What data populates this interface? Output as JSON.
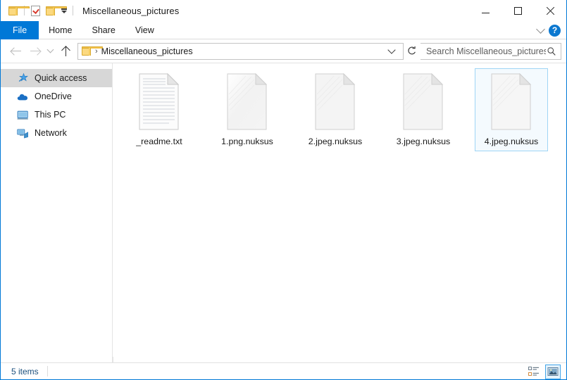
{
  "window": {
    "title": "Miscellaneous_pictures",
    "accent_color": "#0078d7",
    "quick_access_toolbar": [
      {
        "name": "folder-properties-icon",
        "label": ""
      },
      {
        "name": "properties-icon",
        "label": ""
      },
      {
        "name": "new-folder-icon",
        "label": ""
      },
      {
        "name": "customize-dropdown-icon",
        "label": ""
      }
    ],
    "controls": {
      "minimize": "Minimize",
      "maximize": "Maximize",
      "close": "Close"
    }
  },
  "ribbon": {
    "tabs": [
      {
        "label": "File",
        "active": true
      },
      {
        "label": "Home",
        "active": false
      },
      {
        "label": "Share",
        "active": false
      },
      {
        "label": "View",
        "active": false
      }
    ],
    "collapse_label": "",
    "help_label": "?"
  },
  "address": {
    "back_label": "Back",
    "forward_label": "Forward",
    "recent_label": "Recent locations",
    "up_label": "Up",
    "breadcrumb_separator": "›",
    "path": "Miscellaneous_pictures",
    "dropdown_label": "",
    "refresh_label": "Refresh"
  },
  "search": {
    "placeholder": "Search Miscellaneous_pictures",
    "value": ""
  },
  "sidebar": {
    "items": [
      {
        "label": "Quick access",
        "icon": "star-icon",
        "selected": true
      },
      {
        "label": "OneDrive",
        "icon": "cloud-icon",
        "selected": false
      },
      {
        "label": "This PC",
        "icon": "monitor-icon",
        "selected": false
      },
      {
        "label": "Network",
        "icon": "network-icon",
        "selected": false
      }
    ]
  },
  "files": [
    {
      "name": "_readme.txt",
      "type": "text",
      "selected": false
    },
    {
      "name": "1.png.nuksus",
      "type": "generic",
      "selected": false
    },
    {
      "name": "2.jpeg.nuksus",
      "type": "generic",
      "selected": false
    },
    {
      "name": "3.jpeg.nuksus",
      "type": "generic",
      "selected": false
    },
    {
      "name": "4.jpeg.nuksus",
      "type": "generic",
      "selected": true
    }
  ],
  "status": {
    "item_count": "5 items",
    "view_details_label": "Details view",
    "view_large_icons_label": "Large icons view",
    "active_view": "large-icons"
  }
}
